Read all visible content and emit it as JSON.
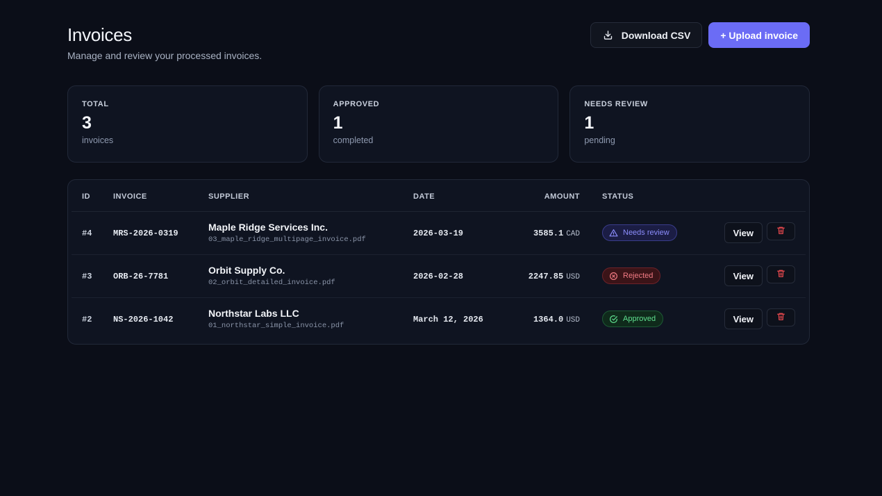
{
  "header": {
    "title": "Invoices",
    "subtitle": "Manage and review your processed invoices.",
    "download_label": "Download CSV",
    "upload_label": "+ Upload invoice"
  },
  "stats": [
    {
      "label": "TOTAL",
      "value": "3",
      "sub": "invoices"
    },
    {
      "label": "APPROVED",
      "value": "1",
      "sub": "completed"
    },
    {
      "label": "NEEDS REVIEW",
      "value": "1",
      "sub": "pending"
    }
  ],
  "table": {
    "columns": {
      "id": "ID",
      "invoice": "INVOICE",
      "supplier": "SUPPLIER",
      "date": "DATE",
      "amount": "AMOUNT",
      "status": "STATUS"
    },
    "rows": [
      {
        "id": "#4",
        "invoice": "MRS-2026-0319",
        "supplier": "Maple Ridge Services Inc.",
        "file": "03_maple_ridge_multipage_invoice.pdf",
        "date": "2026-03-19",
        "amount": "3585.1",
        "currency": "CAD",
        "status": "Needs review",
        "status_type": "review",
        "view_label": "View"
      },
      {
        "id": "#3",
        "invoice": "ORB-26-7781",
        "supplier": "Orbit Supply Co.",
        "file": "02_orbit_detailed_invoice.pdf",
        "date": "2026-02-28",
        "amount": "2247.85",
        "currency": "USD",
        "status": "Rejected",
        "status_type": "rejected",
        "view_label": "View"
      },
      {
        "id": "#2",
        "invoice": "NS-2026-1042",
        "supplier": "Northstar Labs LLC",
        "file": "01_northstar_simple_invoice.pdf",
        "date": "March 12, 2026",
        "amount": "1364.0",
        "currency": "USD",
        "status": "Approved",
        "status_type": "approved",
        "view_label": "View"
      }
    ]
  },
  "colors": {
    "background": "#0b0e18",
    "accent": "#6b6cf5",
    "review": "#8c8dfc",
    "rejected": "#f27b84",
    "approved": "#5fe08f",
    "delete": "#e5484d"
  }
}
